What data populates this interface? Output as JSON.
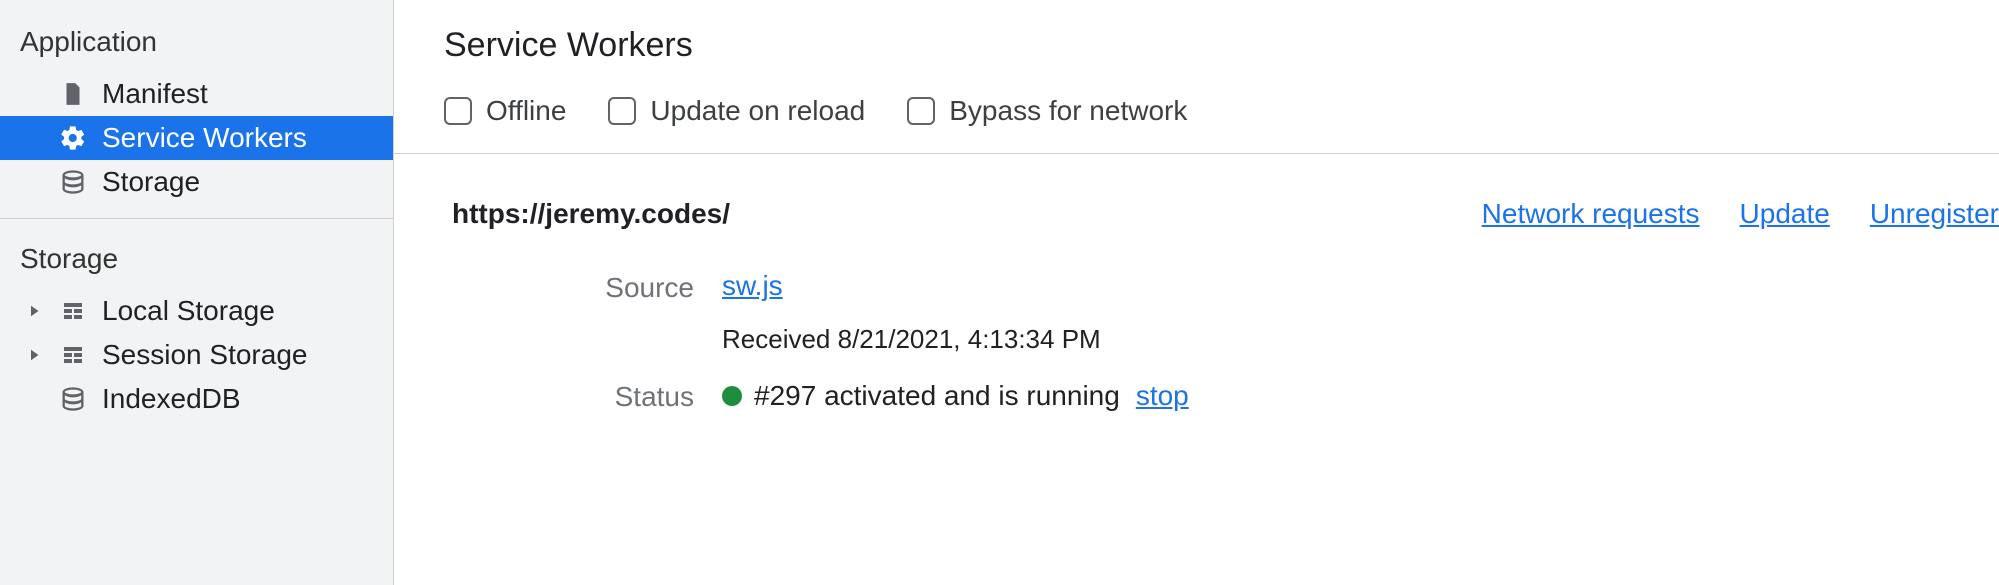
{
  "sidebar": {
    "section_app": "Application",
    "manifest": "Manifest",
    "service_workers": "Service Workers",
    "storage_item": "Storage",
    "section_storage": "Storage",
    "local_storage": "Local Storage",
    "session_storage": "Session Storage",
    "indexeddb": "IndexedDB"
  },
  "main": {
    "title": "Service Workers",
    "options": {
      "offline": "Offline",
      "update_on_reload": "Update on reload",
      "bypass_for_network": "Bypass for network"
    },
    "origin": "https://jeremy.codes/",
    "links": {
      "network_requests": "Network requests",
      "update": "Update",
      "unregister": "Unregister"
    },
    "labels": {
      "source": "Source",
      "status": "Status"
    },
    "source_file": "sw.js",
    "received": "Received 8/21/2021, 4:13:34 PM",
    "status_text": "#297 activated and is running",
    "stop": "stop"
  }
}
